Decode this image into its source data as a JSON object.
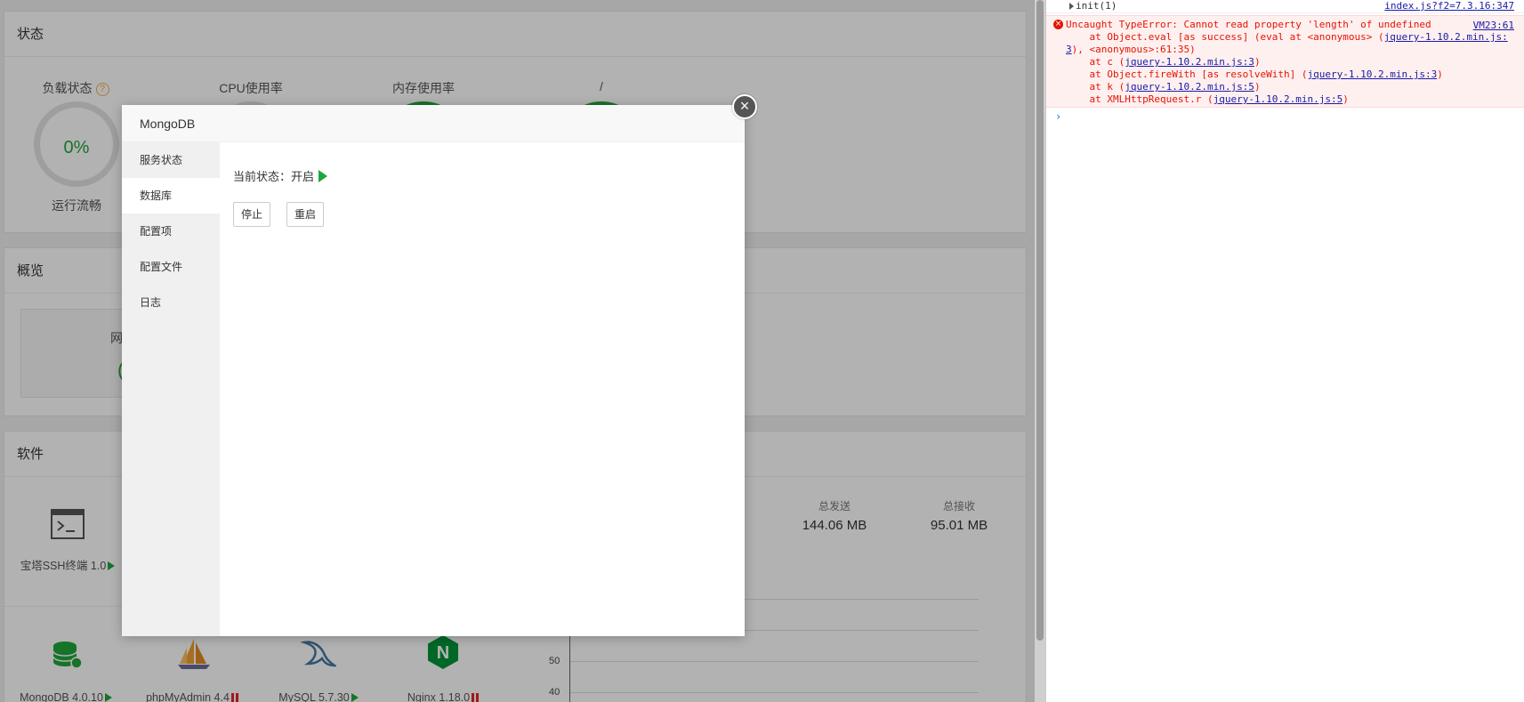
{
  "status_panel": {
    "title": "状态",
    "gauges": [
      {
        "label": "负载状态",
        "value": "0%",
        "sub": "运行流畅",
        "help": "?"
      },
      {
        "label": "CPU使用率"
      },
      {
        "label": "内存使用率"
      },
      {
        "label": "/"
      }
    ]
  },
  "overview_panel": {
    "title": "概览",
    "partial_text": "网",
    "partial_value": "("
  },
  "software_panel": {
    "title": "软件",
    "top_item": {
      "label": "宝塔SSH终端 1.0"
    },
    "bottom_items": [
      {
        "label": "MongoDB 4.0.10",
        "state": "running"
      },
      {
        "label": "phpMyAdmin 4.4",
        "state": "stopped"
      },
      {
        "label": "MySQL 5.7.30",
        "state": "running"
      },
      {
        "label": "Nginx 1.18.0",
        "state": "stopped"
      }
    ],
    "nginx_letter": "N"
  },
  "network": {
    "sent_label": "总发送",
    "sent_value": "144.06 MB",
    "recv_label": "总接收",
    "recv_value": "95.01 MB",
    "y_ticks": [
      "50",
      "40"
    ]
  },
  "modal": {
    "title": "MongoDB",
    "close_symbol": "×",
    "sidebar": [
      "服务状态",
      "数据库",
      "配置项",
      "配置文件",
      "日志"
    ],
    "active_index": 1,
    "status_label": "当前状态：",
    "status_value": "开启",
    "buttons": {
      "stop": "停止",
      "restart": "重启"
    }
  },
  "devtools": {
    "row1_text": "init(1)",
    "row1_link": "index.js?f2=7.3.16:347",
    "error_icon": "×",
    "error_vm_link": "VM23:61",
    "error_message": "Uncaught TypeError: Cannot read property 'length' of undefined",
    "stack": [
      {
        "prefix": "    at Object.eval [as success] (eval at <anonymous> (",
        "link": "jquery-1.10.2.min.js:",
        "suffix": ""
      },
      {
        "prefix": "",
        "link": "3",
        "suffix": "), <anonymous>:61:35)"
      },
      {
        "prefix": "    at c (",
        "link": "jquery-1.10.2.min.js:3",
        "suffix": ")"
      },
      {
        "prefix": "    at Object.fireWith [as resolveWith] (",
        "link": "jquery-1.10.2.min.js:3",
        "suffix": ")"
      },
      {
        "prefix": "    at k (",
        "link": "jquery-1.10.2.min.js:5",
        "suffix": ")"
      },
      {
        "prefix": "    at XMLHttpRequest.r (",
        "link": "jquery-1.10.2.min.js:5",
        "suffix": ")"
      }
    ],
    "prompt": "›"
  },
  "colors": {
    "accent_green": "#20a53a",
    "error_red": "#e51400",
    "link_blue": "#1a1aa6"
  }
}
